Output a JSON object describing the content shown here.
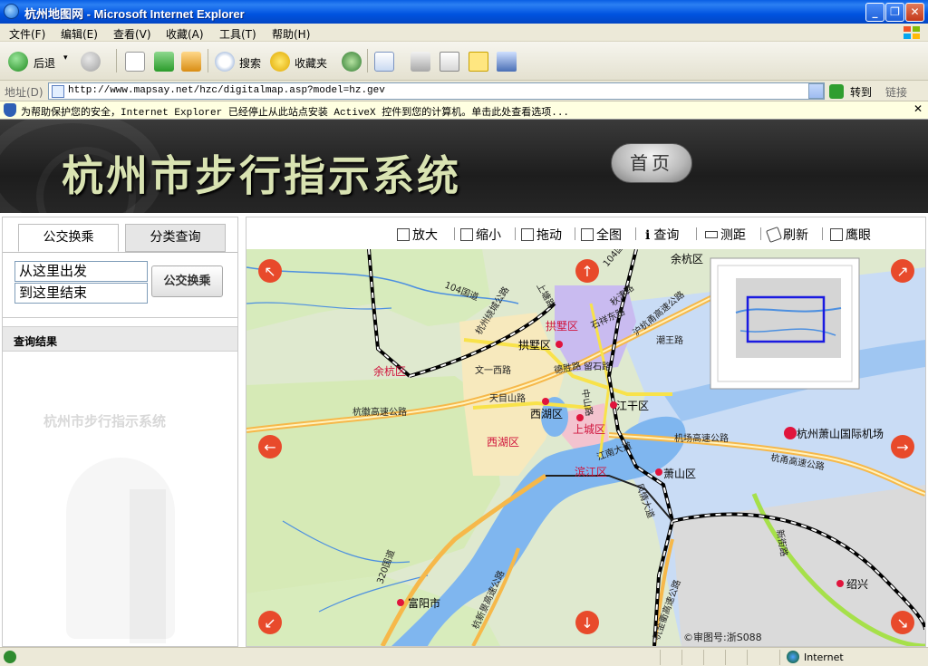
{
  "window": {
    "title": "杭州地图网 - Microsoft Internet Explorer",
    "controls": [
      "_",
      "❐",
      "✕"
    ]
  },
  "menu": [
    "文件(F)",
    "编辑(E)",
    "查看(V)",
    "收藏(A)",
    "工具(T)",
    "帮助(H)"
  ],
  "toolbar": {
    "back": "后退",
    "search": "搜索",
    "favorites": "收藏夹"
  },
  "address": {
    "label": "地址(D)",
    "url": "http://www.mapsay.net/hzc/digitalmap.asp?model=hz.gev",
    "go": "转到",
    "links": "链接"
  },
  "infobar": {
    "text": "为帮助保护您的安全，Internet Explorer 已经停止从此站点安装 ActiveX 控件到您的计算机。单击此处查看选项...",
    "close": "✕"
  },
  "banner": {
    "title": "杭州市步行指示系统",
    "home": "首页"
  },
  "left": {
    "tab_bus": "公交换乘",
    "tab_category": "分类查询",
    "from": "从这里出发",
    "to": "到这里结束",
    "button": "公交换乘",
    "results_header": "查询结果",
    "watermark": "杭州市步行指示系统"
  },
  "map_tools": {
    "zoom_in": "放大",
    "zoom_out": "缩小",
    "pan": "拖动",
    "full": "全图",
    "query": "查询",
    "measure": "测距",
    "refresh": "刷新",
    "eagle": "鹰眼"
  },
  "map": {
    "labels": {
      "yuhang_n": "余杭区",
      "gongshu_dist": "拱墅区",
      "gongshu": "拱墅区",
      "yuhang": "余杭区",
      "xihu_dist": "西湖区",
      "xihu": "西湖区",
      "jianggan": "江干区",
      "shangcheng": "上城区",
      "binjiang": "滨江区",
      "xiaoshan": "萧山区",
      "airport": "杭州萧山国际机场",
      "fuyang": "富阳市",
      "shaoxing": "绍兴",
      "road_104": "104国道",
      "road_hangzhou_bypass": "杭州绕城公路",
      "road_shangtang": "上塘路",
      "road_320": "320国道",
      "road_wenyi": "文一西路",
      "road_tianmushan": "天目山路",
      "road_hanghui": "杭徽高速公路",
      "road_jichang": "机场高速公路",
      "road_hangyong": "杭甬高速公路",
      "road_dedeng": "德胜路",
      "road_shixiang": "石祥东路",
      "road_huning": "沪杭甬高速公路",
      "road_jiangnan": "江南大道",
      "road_qiutao": "秋涛路",
      "road_fengqing": "风情大道",
      "road_xinjie": "新街路",
      "road_hangxin": "杭新景高速公路",
      "road_hangjin": "杭金衢高速公路",
      "road_104_south": "104国道",
      "road_chaowang": "潮王路",
      "road_zhongshan": "中山路",
      "road_shu": "留石路",
      "copyright": "©审图号:浙S088"
    }
  },
  "status": {
    "zone": "Internet"
  }
}
